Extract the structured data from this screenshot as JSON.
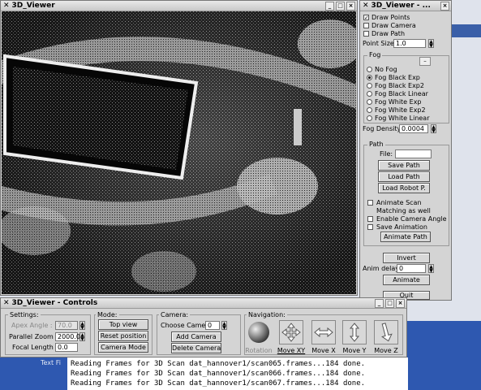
{
  "viewer_window": {
    "title": "3D_Viewer"
  },
  "options_window": {
    "title": "3D_Viewer - ...",
    "draw_points": "Draw Points",
    "draw_camera": "Draw Camera",
    "draw_path": "Draw Path",
    "point_size_label": "Point Size:",
    "point_size_value": "1.0",
    "fog_title": "Fog",
    "fog_options": [
      "No Fog",
      "Fog Black Exp",
      "Fog Black Exp2",
      "Fog Black Linear",
      "Fog White Exp",
      "Fog White Exp2",
      "Fog White Linear"
    ],
    "fog_selected": "Fog Black Exp",
    "fog_density_label": "Fog Density:",
    "fog_density_value": "0.0004",
    "path_title": "Path",
    "file_label": "File:",
    "save_path": "Save Path",
    "load_path": "Load Path",
    "load_robot": "Load Robot P.",
    "animate_scan": "Animate Scan",
    "matching_as_well": "Matching as well",
    "enable_camera_angle": "Enable Camera Angle",
    "save_animation": "Save Animation",
    "animate_path": "Animate Path",
    "invert": "Invert",
    "anim_delay_label": "Anim delay:",
    "anim_delay_value": "0",
    "animate": "Animate",
    "quit": "Quit"
  },
  "controls_window": {
    "title": "3D_Viewer - Controls",
    "settings_title": "Settings:",
    "apex_angle_label": "Apex Angle :",
    "apex_angle_value": "70.0",
    "parallel_zoom_label": "Parallel Zoom :",
    "parallel_zoom_value": "2000.0",
    "focal_length_label": "Focal Length :",
    "focal_length_value": "0.0",
    "mode_title": "Mode:",
    "top_view": "Top view",
    "reset_position": "Reset position",
    "camera_mode": "Camera Mode",
    "camera_title": "Camera:",
    "choose_camera_label": "Choose Camera",
    "choose_camera_value": "0",
    "add_camera": "Add Camera",
    "delete_camera": "Delete Camera",
    "navigation_title": "Navigation:",
    "rotation": "Rotation",
    "move_xy": "Move XY",
    "move_x": "Move X",
    "move_y": "Move Y",
    "move_z": "Move Z"
  },
  "terminal": {
    "label": "Text Fi",
    "lines": [
      "Reading Frames for 3D Scan dat_hannover1/scan065.frames...184 done.",
      "Reading Frames for 3D Scan dat_hannover1/scan066.frames...184 done.",
      "Reading Frames for 3D Scan dat_hannover1/scan067.frames...184 done."
    ]
  }
}
